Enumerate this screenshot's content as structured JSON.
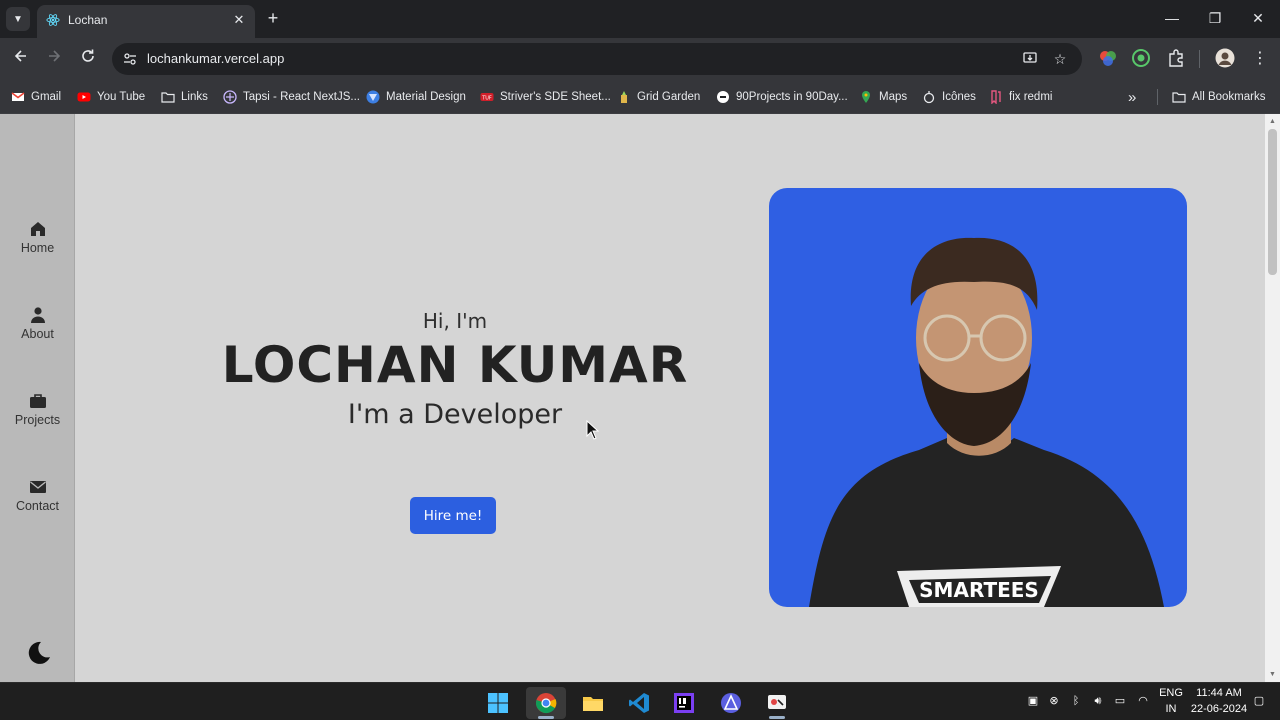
{
  "browser": {
    "tab_title": "Lochan",
    "tab_close": "✕",
    "new_tab": "+",
    "url": "lochankumar.vercel.app",
    "window_controls": {
      "minimize": "—",
      "maximize": "❐",
      "close": "✕"
    }
  },
  "bookmarks": [
    {
      "label": "Gmail",
      "icon": "gmail-icon"
    },
    {
      "label": "You Tube",
      "icon": "youtube-icon"
    },
    {
      "label": "Links",
      "icon": "folder-icon"
    },
    {
      "label": "Tapsi - React NextJS...",
      "icon": "tapsi-icon"
    },
    {
      "label": "Material Design",
      "icon": "material-design-icon"
    },
    {
      "label": "Striver's SDE Sheet...",
      "icon": "tuf-icon"
    },
    {
      "label": "Grid Garden",
      "icon": "grid-garden-icon"
    },
    {
      "label": "90Projects in 90Day...",
      "icon": "projects-icon"
    },
    {
      "label": "Maps",
      "icon": "maps-icon"
    },
    {
      "label": "Icônes",
      "icon": "icones-icon"
    },
    {
      "label": "fix redmi",
      "icon": "bookmark-icon"
    }
  ],
  "bookmarks_overflow": "»",
  "all_bookmarks": "All Bookmarks",
  "sidebar": {
    "items": [
      {
        "label": "Home",
        "icon": "home-icon"
      },
      {
        "label": "About",
        "icon": "user-icon"
      },
      {
        "label": "Projects",
        "icon": "briefcase-icon"
      },
      {
        "label": "Contact",
        "icon": "mail-icon"
      }
    ],
    "theme_toggle_icon": "moon-icon"
  },
  "hero": {
    "greeting": "Hi, I'm",
    "name": "LOCHAN KUMAR",
    "role": "I'm a Developer",
    "cta": "Hire me!",
    "photo_shirt_text": "SMARTEES"
  },
  "colors": {
    "page_bg": "#d5d5d5",
    "sidebar_bg": "#b9b9b9",
    "accent_blue": "#2c5fe0",
    "photo_bg": "#2f5fe3"
  },
  "taskbar": {
    "language_top": "ENG",
    "language_bottom": "IN",
    "time": "11:44 AM",
    "date": "22-06-2024"
  }
}
